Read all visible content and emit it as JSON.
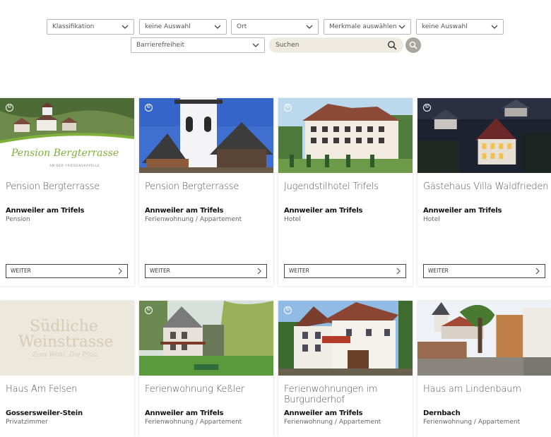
{
  "filters": {
    "klassifikation": "Klassifikation",
    "auswahl1": "keine Auswahl",
    "ort": "Ort",
    "merkmale": "Merkmale auswählen",
    "auswahl2": "keine Auswahl",
    "barrierefreiheit": "Barrierefreiheit",
    "search_placeholder": "Suchen"
  },
  "cards": [
    {
      "title": "Pension Bergterrasse",
      "place": "Annweiler am Trifels",
      "category": "Pension",
      "button": "WEITER",
      "logo": "Pension Bergterrasse",
      "logo_sub": "AN DER FRIEDENSKAPELLE"
    },
    {
      "title": "Pension Bergterrasse",
      "place": "Annweiler am Trifels",
      "category": "Ferienwohnung / Appartement",
      "button": "WEITER"
    },
    {
      "title": "Jugendstilhotel Trifels",
      "place": "Annweiler am Trifels",
      "category": "Hotel",
      "button": "WEITER"
    },
    {
      "title": "Gästehaus Villa Waldfrieden",
      "place": "Annweiler am Trifels",
      "category": "Hotel",
      "button": "WEITER"
    },
    {
      "title": "Haus Am Felsen",
      "place": "Gossersweiler-Stein",
      "category": "Privatzimmer",
      "logo1": "Südliche",
      "logo2": "Weinstrasse",
      "logo3": "Zum Wohl. Die Pfalz."
    },
    {
      "title": "Ferienwohnung Keßler",
      "place": "Annweiler am Trifels",
      "category": "Ferienwohnung / Appartement"
    },
    {
      "title_line1": "Ferienwohnungen im",
      "title_line2": "Burgunderhof",
      "place": "Annweiler am Trifels",
      "category": "Ferienwohnung / Appartement"
    },
    {
      "title": "Haus am Lindenbaum",
      "place": "Dernbach",
      "category": "Ferienwohnung / Appartement"
    }
  ],
  "copyright_symbol": "©"
}
